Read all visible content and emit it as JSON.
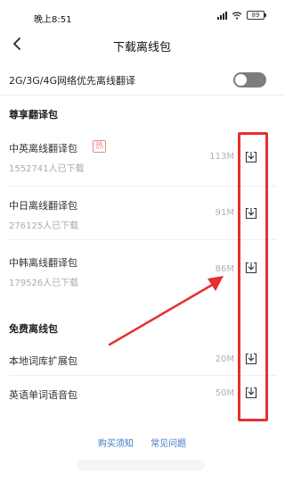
{
  "status_bar": {
    "time": "晚上8:51",
    "battery": "89"
  },
  "header": {
    "title": "下载离线包"
  },
  "setting": {
    "label": "2G/3G/4G网络优先离线翻译",
    "enabled": false
  },
  "sections": [
    {
      "title": "尊享翻译包",
      "items": [
        {
          "name": "中英离线翻译包",
          "badge": "热",
          "count": "1552741人已下载",
          "size": "113M"
        },
        {
          "name": "中日离线翻译包",
          "count": "276125人已下载",
          "size": "91M"
        },
        {
          "name": "中韩离线翻译包",
          "count": "179526人已下载",
          "size": "86M"
        }
      ]
    },
    {
      "title": "免费离线包",
      "items": [
        {
          "name": "本地词库扩展包",
          "size": "20M"
        },
        {
          "name": "英语单词语音包",
          "size": "50M"
        }
      ]
    }
  ],
  "footer": {
    "link1": "购买须知",
    "link2": "常见问题"
  },
  "annotation": {
    "highlight_color": "#e53030"
  },
  "icons": {
    "back": "chevron-left-icon",
    "download": "download-icon",
    "wifi": "wifi-icon",
    "signal": "signal-icon",
    "battery": "battery-icon"
  }
}
